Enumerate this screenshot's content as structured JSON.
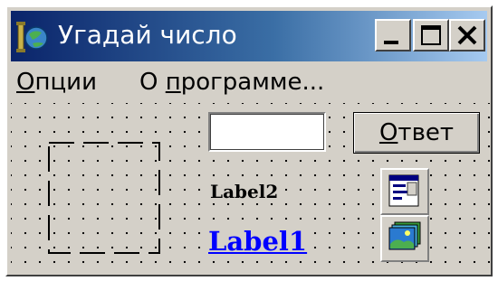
{
  "window": {
    "title": "Угадай число",
    "icons": {
      "app": "guess-app-icon",
      "minimize": "minimize-icon",
      "maximize": "maximize-icon",
      "close": "close-icon"
    },
    "titlebar_colors": [
      "#0a246a",
      "#a6caf0"
    ]
  },
  "menu": {
    "item1": {
      "accel": "О",
      "rest": "пции"
    },
    "item2": {
      "before": "О ",
      "accel": "п",
      "rest": "рограмме..."
    }
  },
  "form": {
    "edit_value": "",
    "button": {
      "accel": "О",
      "rest": "твет"
    },
    "label2": "Label2",
    "label1": "Label1",
    "label1_color": "#0000ff",
    "components": [
      "popup-menu-component-icon",
      "image-list-component-icon"
    ],
    "timer_shape": "dashed-frame-icon"
  }
}
